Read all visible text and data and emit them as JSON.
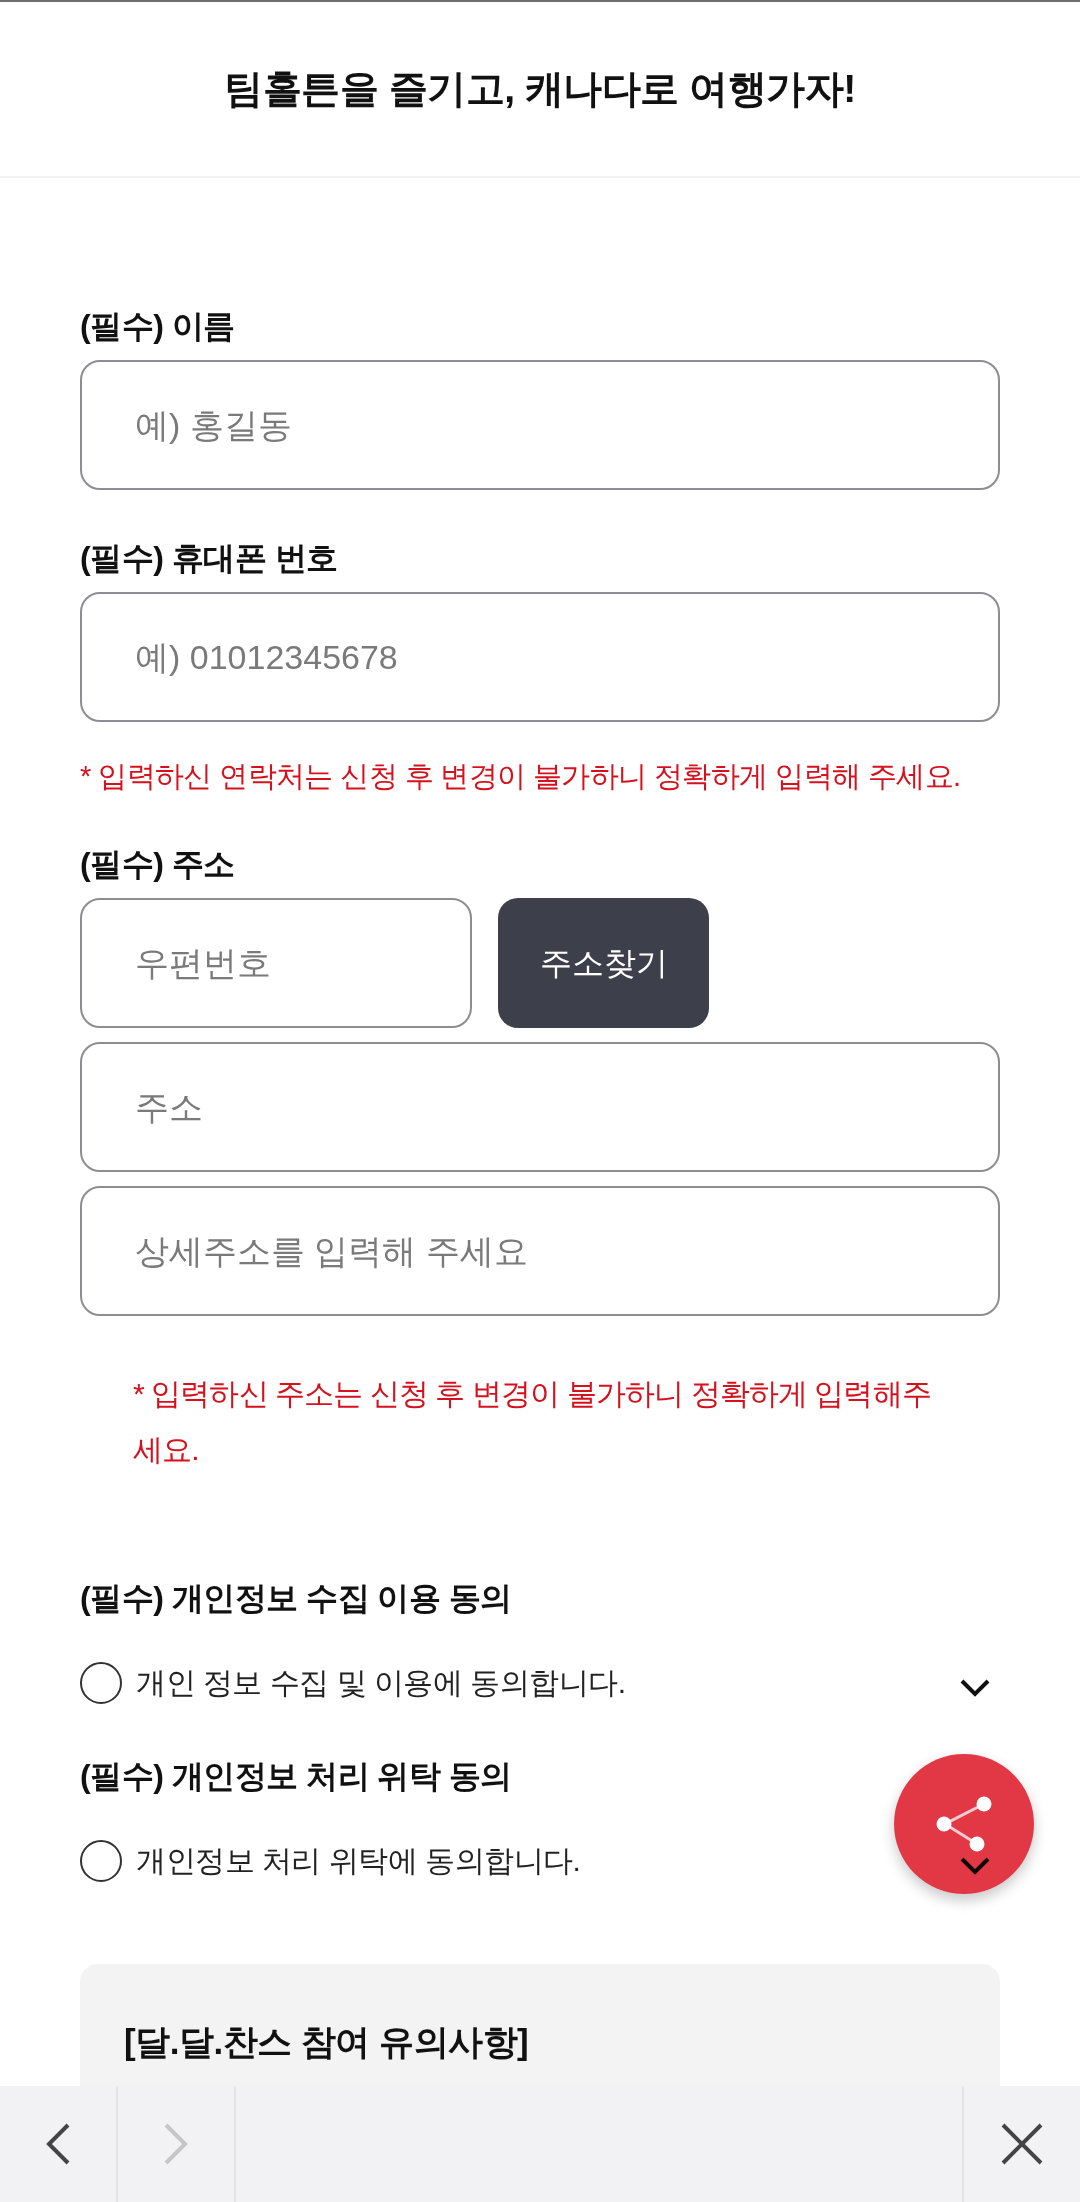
{
  "header": {
    "title": "팀홀튼을 즐기고, 캐나다로 여행가자!"
  },
  "fields": [
    {
      "kind": "text",
      "label": "(필수) 이름",
      "inputs": [
        {
          "placeholder": "예) 홍길동"
        }
      ]
    },
    {
      "kind": "text",
      "label": "(필수) 휴대폰 번호",
      "inputs": [
        {
          "placeholder": "예) 01012345678"
        }
      ],
      "note": "* 입력하신 연락처는 신청 후 변경이 불가하니 정확하게 입력해 주세요."
    },
    {
      "kind": "address",
      "label": "(필수) 주소",
      "postcode": {
        "placeholder": "우편번호"
      },
      "search_button": "주소찾기",
      "inputs": [
        {
          "placeholder": "주소"
        },
        {
          "placeholder": "상세주소를 입력해 주세요"
        }
      ],
      "note": "* 입력하신 주소는 신청 후 변경이 불가하니 정확하게 입력해주세요."
    }
  ],
  "consents": [
    {
      "title": "(필수) 개인정보 수집 이용 동의",
      "label": "개인 정보 수집 및 이용에 동의합니다.",
      "checked": false,
      "expanded": false
    },
    {
      "title": "(필수) 개인정보 처리 위탁 동의",
      "label": "개인정보 처리 위탁에 동의합니다.",
      "checked": false,
      "expanded": false
    }
  ],
  "notice": {
    "title": "[달.달.찬스 참여 유의사항]"
  },
  "nav": {
    "back": {
      "disabled": false
    },
    "forward": {
      "disabled": true
    }
  }
}
